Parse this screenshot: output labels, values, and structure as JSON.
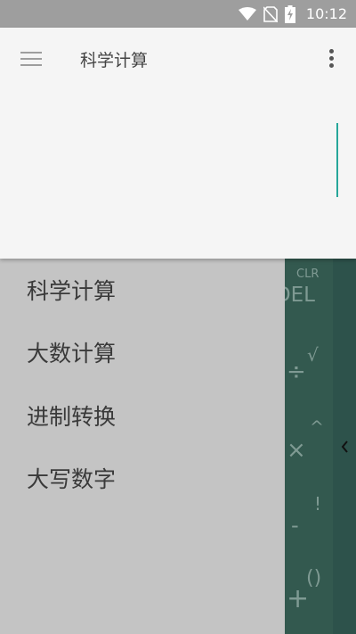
{
  "status_bar": {
    "time": "10:12",
    "icons": [
      "wifi-icon",
      "no-sim-icon",
      "battery-charging-icon"
    ]
  },
  "app_bar": {
    "title": "科学计算",
    "menu_icon": "hamburger-menu-icon",
    "overflow_icon": "more-vert-icon"
  },
  "drawer": {
    "items": [
      {
        "label": "科学计算"
      },
      {
        "label": "大数计算"
      },
      {
        "label": "进制转换"
      },
      {
        "label": "大写数字"
      }
    ]
  },
  "keypad": {
    "clr": "CLR",
    "del": "DEL",
    "sqrt": "√",
    "divide": "÷",
    "power": "^",
    "multiply": "×",
    "factorial": "!",
    "minus": "-",
    "parens": "()",
    "plus": "+"
  },
  "colors": {
    "accent": "#26a69a",
    "status_bar": "#9e9e9e",
    "drawer_bg": "#c4c4c4",
    "keypad_bg": "#33594f"
  }
}
